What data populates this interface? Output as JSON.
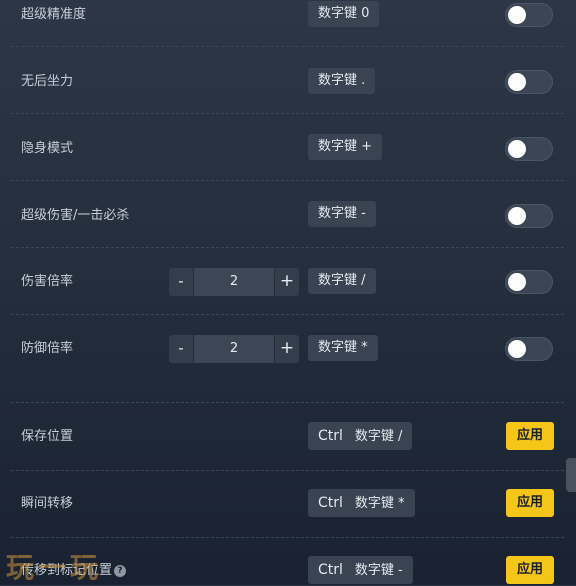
{
  "rows": [
    {
      "label": "超级精准度",
      "hotkey": "数字键 0"
    },
    {
      "label": "无后坐力",
      "hotkey": "数字键 ."
    },
    {
      "label": "隐身模式",
      "hotkey": "数字键 +"
    },
    {
      "label": "超级伤害/一击必杀",
      "hotkey": "数字键 -"
    },
    {
      "label": "伤害倍率",
      "hotkey": "数字键 /",
      "stepper": {
        "minus": "-",
        "value": "2",
        "plus": "+"
      }
    },
    {
      "label": "防御倍率",
      "hotkey": "数字键 *",
      "stepper": {
        "minus": "-",
        "value": "2",
        "plus": "+"
      }
    }
  ],
  "actions": [
    {
      "label": "保存位置",
      "ctrl": "Ctrl",
      "hotkey": "数字键 /",
      "apply": "应用"
    },
    {
      "label": "瞬间转移",
      "ctrl": "Ctrl",
      "hotkey": "数字键 *",
      "apply": "应用"
    },
    {
      "label": "传移到标记位置",
      "ctrl": "Ctrl",
      "hotkey": "数字键 -",
      "apply": "应用"
    }
  ],
  "toggles": {
    "states": [
      false,
      false,
      false,
      false,
      false,
      false
    ]
  },
  "watermark": "玩一玩",
  "help_icon": "?",
  "colors": {
    "apply_button": "#f5c518",
    "toggle_track": "#3b4554"
  }
}
